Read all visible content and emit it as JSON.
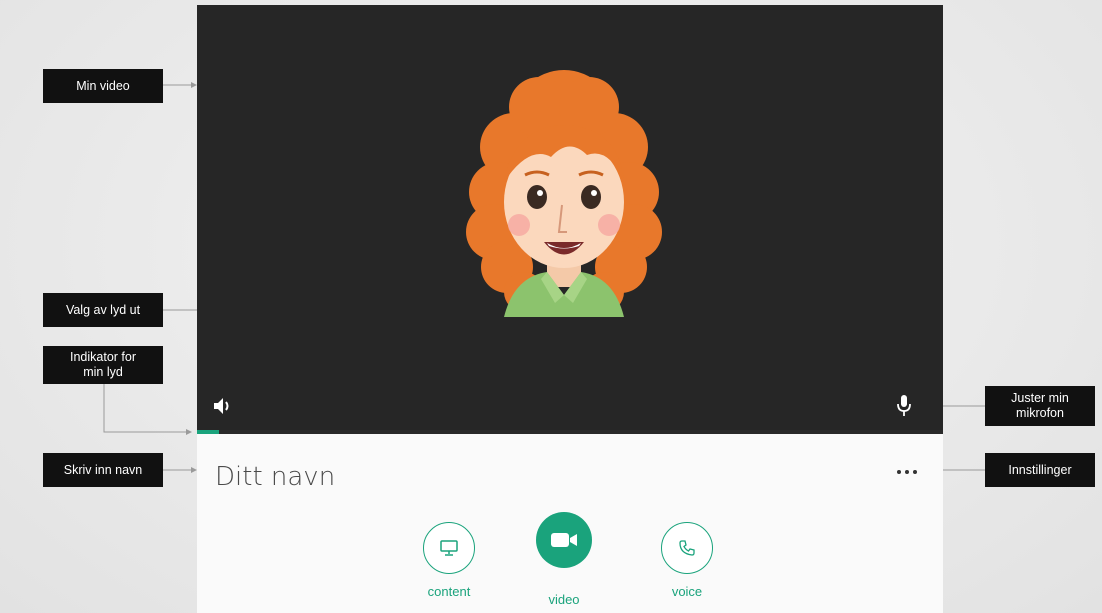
{
  "annotations": {
    "min_video": "Min video",
    "valg_lyd_ut": "Valg av lyd ut",
    "indikator_lyd": "Indikator for min lyd",
    "skriv_navn": "Skriv inn navn",
    "juster_mikrofon": "Juster min mikrofon",
    "innstillinger": "Innstillinger"
  },
  "name_input": {
    "placeholder": "Ditt navn",
    "value": ""
  },
  "controls": {
    "content_label": "content",
    "video_label": "video",
    "voice_label": "voice"
  },
  "audio_level": {
    "fraction": 0.03
  },
  "colors": {
    "accent": "#1aa37c",
    "video_bg": "#262626",
    "callout_bg": "#111111"
  },
  "icons": {
    "speaker": "speaker-icon",
    "mic": "microphone-icon",
    "more": "more-dots-icon",
    "content": "monitor-icon",
    "video": "video-camera-icon",
    "voice": "phone-icon"
  }
}
